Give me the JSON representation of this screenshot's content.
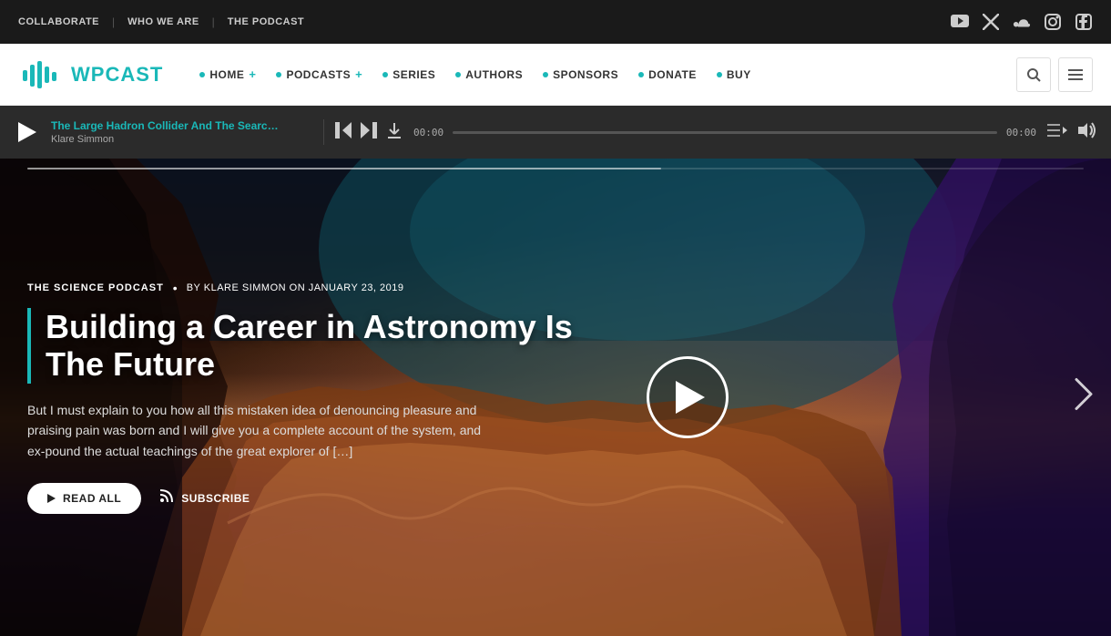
{
  "topBar": {
    "navItems": [
      "COLLABORATE",
      "WHO WE ARE",
      "THE PODCAST"
    ],
    "socialIcons": [
      "youtube",
      "twitter-x",
      "soundcloud",
      "instagram",
      "facebook"
    ]
  },
  "mainNav": {
    "logoText": "WP",
    "logoSubtext": "CAST",
    "menuItems": [
      {
        "label": "HOME",
        "hasPlus": true
      },
      {
        "label": "PODCASTS",
        "hasPlus": true
      },
      {
        "label": "SERIES",
        "hasPlus": false
      },
      {
        "label": "AUTHORS",
        "hasPlus": false
      },
      {
        "label": "SPONSORS",
        "hasPlus": false
      },
      {
        "label": "DONATE",
        "hasPlus": false
      },
      {
        "label": "BUY",
        "hasPlus": false
      }
    ]
  },
  "player": {
    "trackTitle": "The Large Hadron Collider And The Searc…",
    "trackAuthor": "Klare Simmon",
    "currentTime": "00:00",
    "totalTime": "00:00"
  },
  "hero": {
    "category": "THE SCIENCE PODCAST",
    "authorLine": "BY KLARE SIMMON ON JANUARY 23, 2019",
    "title": "Building a Career in Astronomy Is The Future",
    "excerpt": "But I must explain to you how all this mistaken idea of denouncing pleasure and praising pain was born and I will give you a complete account of the system, and ex-pound the actual teachings of the great explorer of […]",
    "readAllLabel": "READ ALL",
    "subscribeLabel": "SUBSCRIBE"
  }
}
